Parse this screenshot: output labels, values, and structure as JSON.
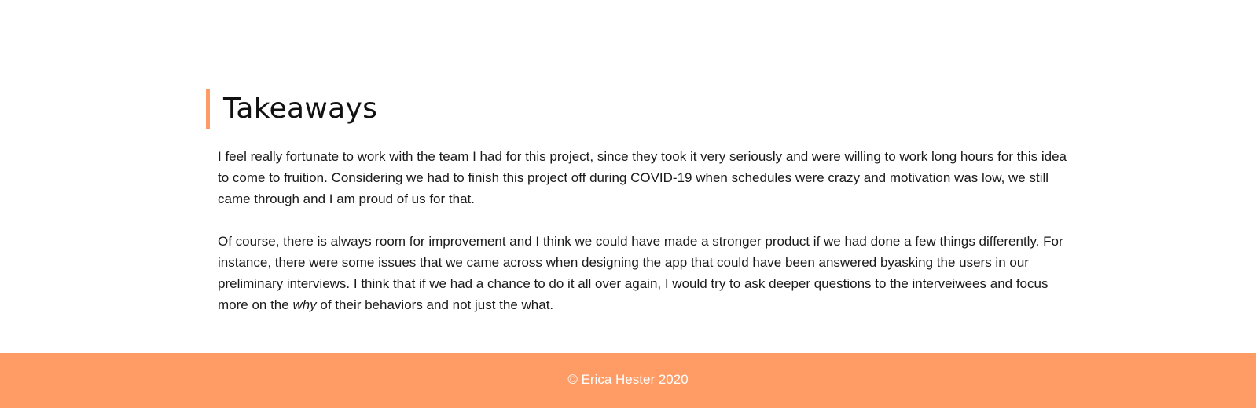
{
  "section": {
    "title": "Takeaways",
    "paragraph1": "I feel really fortunate to work with the team I had for this project, since they took it very seriously and were willing to work long hours for this idea to come to fruition. Considering we had to finish this project off during COVID-19 when schedules were crazy and motivation was low, we still came through and I am proud of us for that.",
    "paragraph2_before": "Of course, there is always room for improvement and I think we could have made a stronger product if we had done a few things differently. For instance, there were some issues that we came across when designing the app that could have been answered byasking the users in our preliminary interviews. I think that if we had a chance to do it all over again, I would try to ask deeper questions to the interveiwees and focus more on the ",
    "paragraph2_emphasis": "why",
    "paragraph2_after": " of their behaviors and not just the what."
  },
  "footer": {
    "copyright": "© Erica Hester 2020"
  },
  "colors": {
    "accent": "#ff9c66",
    "footer_text": "#ffffff"
  }
}
